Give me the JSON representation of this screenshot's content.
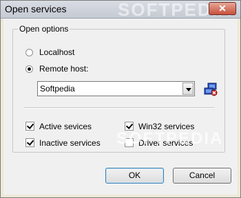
{
  "window": {
    "title": "Open services",
    "watermark": "SOFTPEDIA",
    "close_label": "✕"
  },
  "group": {
    "legend": "Open options",
    "radio_localhost": {
      "label": "Localhost",
      "checked": false
    },
    "radio_remote": {
      "label": "Remote host:",
      "checked": true
    },
    "remote_host_value": "Softpedia",
    "browse_icon": "network-computer-icon"
  },
  "services": {
    "active": {
      "label": "Active sevices",
      "checked": true
    },
    "win32": {
      "label": "Win32 services",
      "checked": true
    },
    "inactive": {
      "label": "Inactive services",
      "checked": true
    },
    "driver": {
      "label": "Driver services",
      "checked": false
    },
    "watermark": "SOFTPEDIA"
  },
  "buttons": {
    "ok_label": "OK",
    "cancel_label": "Cancel"
  }
}
